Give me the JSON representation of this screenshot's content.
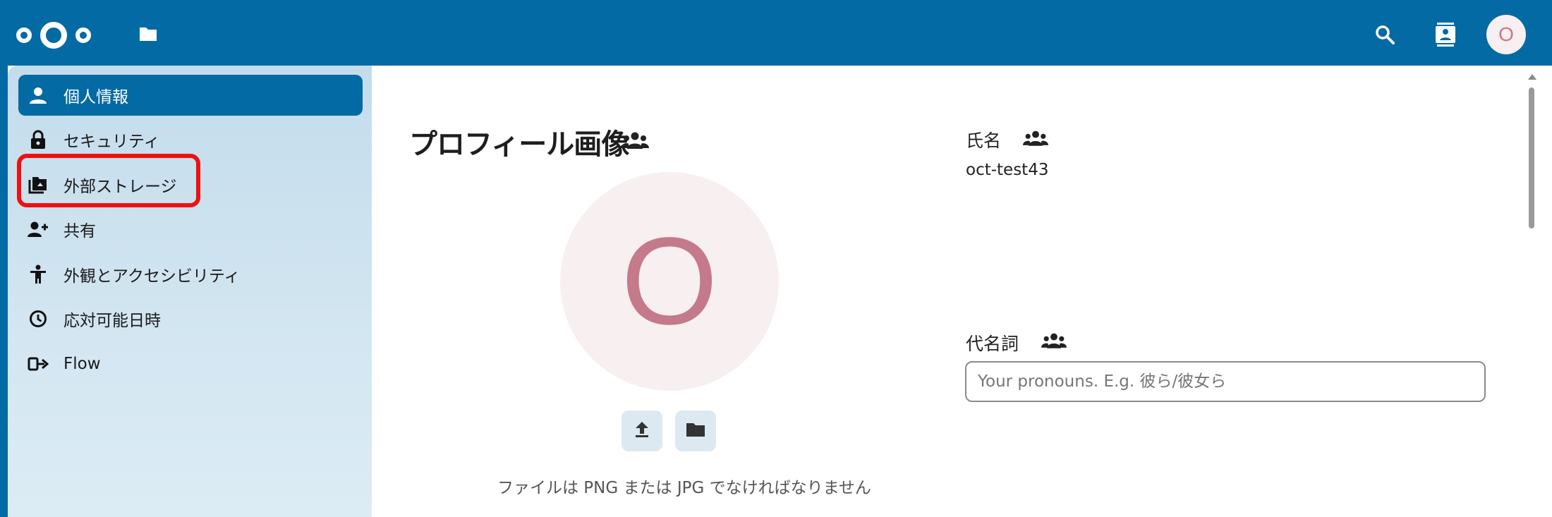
{
  "header": {
    "logo_label": "Nextcloud",
    "icons": [
      "files-icon",
      "search-icon",
      "contacts-icon"
    ],
    "avatar_initial": "O"
  },
  "sidebar": {
    "items": [
      {
        "label": "個人情報",
        "icon": "person-icon",
        "active": true
      },
      {
        "label": "セキュリティ",
        "icon": "lock-icon",
        "active": false
      },
      {
        "label": "外部ストレージ",
        "icon": "external-storage-icon",
        "active": false
      },
      {
        "label": "共有",
        "icon": "share-person-icon",
        "active": false
      },
      {
        "label": "外観とアクセシビリティ",
        "icon": "accessibility-icon",
        "active": false
      },
      {
        "label": "応対可能日時",
        "icon": "clock-icon",
        "active": false
      },
      {
        "label": "Flow",
        "icon": "flow-icon",
        "active": false
      }
    ],
    "highlighted_item": "外部ストレージ"
  },
  "profile_picture": {
    "title": "プロフィール画像",
    "avatar_initial": "O",
    "hint": "ファイルは PNG または JPG でなければなりません",
    "buttons": [
      "upload-icon",
      "folder-icon"
    ]
  },
  "fields": {
    "name": {
      "label": "氏名",
      "value": "oct-test43"
    },
    "pronouns": {
      "label": "代名詞",
      "placeholder": "Your pronouns. E.g. 彼ら/彼女ら",
      "value": ""
    }
  },
  "colors": {
    "header": "#046aa4",
    "active_nav": "#046aa4",
    "highlight_box": "#ef1010",
    "avatar_text": "#c47a8a",
    "avatar_bg": "#f7eff0"
  }
}
